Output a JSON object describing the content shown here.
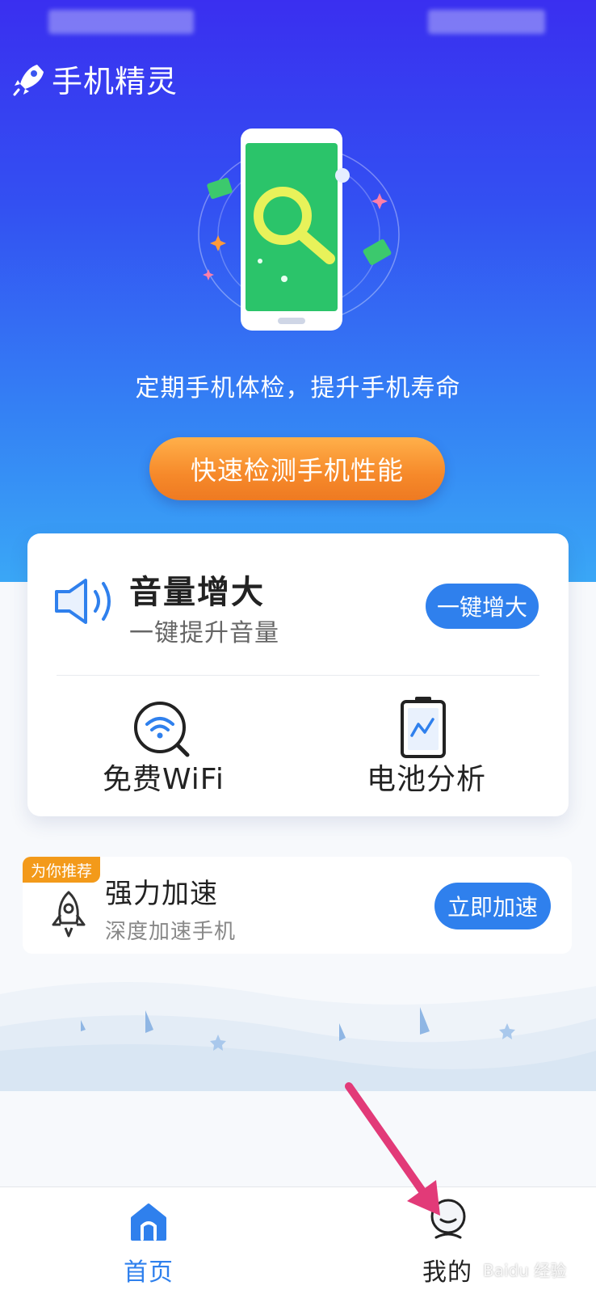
{
  "app": {
    "title": "手机精灵"
  },
  "hero": {
    "tagline": "定期手机体检，提升手机寿命",
    "cta_label": "快速检测手机性能"
  },
  "volume_card": {
    "title": "音量增大",
    "subtitle": "一键提升音量",
    "button_label": "一键增大",
    "tools": [
      {
        "label": "免费WiFi",
        "icon": "wifi-search-icon"
      },
      {
        "label": "电池分析",
        "icon": "battery-analysis-icon"
      }
    ]
  },
  "recommend": {
    "badge": "为你推荐",
    "title": "强力加速",
    "subtitle": "深度加速手机",
    "button_label": "立即加速",
    "icon": "rocket-icon"
  },
  "bottom_nav": {
    "items": [
      {
        "label": "首页",
        "icon": "home-icon",
        "active": true
      },
      {
        "label": "我的",
        "icon": "profile-icon",
        "active": false
      }
    ]
  },
  "watermark": {
    "text": "Baidu 经验"
  },
  "colors": {
    "accent": "#2f80ed",
    "cta_orange": "#f6892a",
    "badge_orange": "#f39a1a",
    "annotation_arrow": "#e23a78"
  }
}
